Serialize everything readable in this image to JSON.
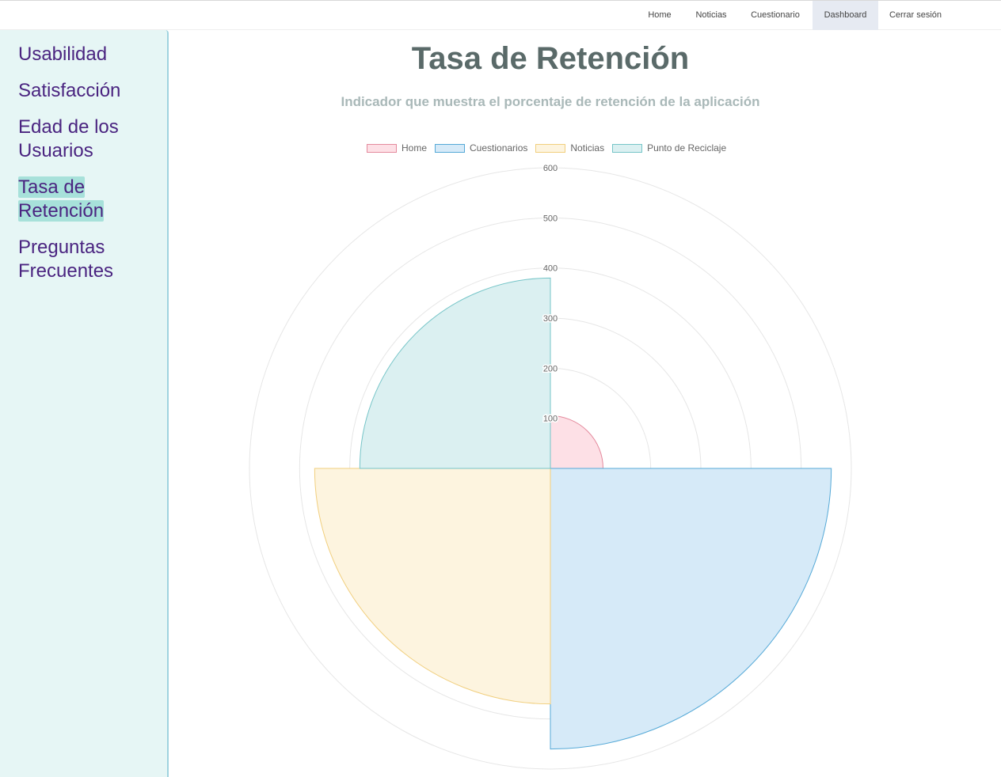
{
  "nav": {
    "items": [
      {
        "label": "Home",
        "active": false
      },
      {
        "label": "Noticias",
        "active": false
      },
      {
        "label": "Cuestionario",
        "active": false
      },
      {
        "label": "Dashboard",
        "active": true
      },
      {
        "label": "Cerrar sesión",
        "active": false
      }
    ]
  },
  "sidebar": {
    "items": [
      {
        "label": "Usabilidad",
        "active": false
      },
      {
        "label": "Satisfacción",
        "active": false
      },
      {
        "label": "Edad de los Usuarios",
        "active": false
      },
      {
        "label": "Tasa de Retención",
        "active": true
      },
      {
        "label": "Preguntas Frecuentes",
        "active": false
      }
    ]
  },
  "page": {
    "title": "Tasa de Retención",
    "subtitle": "Indicador que muestra el porcentaje de retención de la aplicación"
  },
  "chart_data": {
    "type": "polarArea",
    "categories": [
      "Home",
      "Cuestionarios",
      "Noticias",
      "Punto de Reciclaje"
    ],
    "values": [
      105,
      560,
      470,
      380
    ],
    "colors": {
      "fill": [
        "#fde0e6",
        "#d6eaf8",
        "#fdf4df",
        "#dbf0f1"
      ],
      "stroke": [
        "#e48a9d",
        "#55a9d7",
        "#f1cf7e",
        "#76c5c8"
      ]
    },
    "r_ticks": [
      100,
      200,
      300,
      400,
      500,
      600
    ],
    "r_max": 600,
    "grid": true,
    "legend_position": "top"
  }
}
